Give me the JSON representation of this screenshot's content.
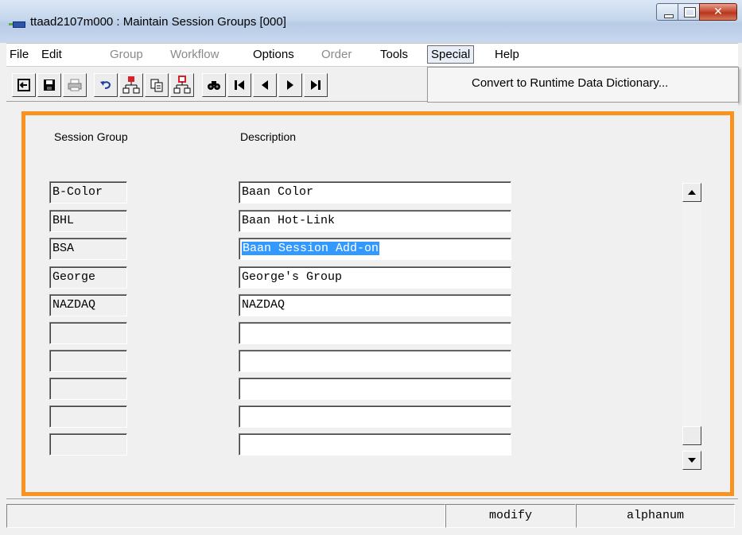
{
  "window": {
    "title": "ttaad2107m000 : Maintain Session Groups [000]"
  },
  "menu": {
    "items": [
      {
        "label": "File",
        "enabled": true
      },
      {
        "label": "Edit",
        "enabled": true
      },
      {
        "label": "Group",
        "enabled": false
      },
      {
        "label": "Workflow",
        "enabled": false
      },
      {
        "label": "Options",
        "enabled": true
      },
      {
        "label": "Order",
        "enabled": false
      },
      {
        "label": "Tools",
        "enabled": true
      },
      {
        "label": "Special",
        "enabled": true,
        "active": true
      },
      {
        "label": "Help",
        "enabled": true
      }
    ]
  },
  "dropdown": {
    "items": [
      "Convert to Runtime Data Dictionary..."
    ]
  },
  "toolbar": {
    "icons": [
      "exit-icon",
      "save-icon",
      "print-icon",
      "undo-icon",
      "insert-record-icon",
      "copy-icon",
      "duplicate-record-icon",
      "find-icon",
      "first-record-icon",
      "previous-record-icon",
      "next-record-icon",
      "last-record-icon"
    ]
  },
  "form": {
    "headers": {
      "code": "Session Group",
      "description": "Description"
    },
    "rows": [
      {
        "code": "B-Color",
        "description": "Baan Color",
        "selected": false
      },
      {
        "code": "BHL",
        "description": "Baan Hot-Link",
        "selected": false
      },
      {
        "code": "BSA",
        "description": "Baan Session Add-on",
        "selected": true
      },
      {
        "code": "George",
        "description": "George's Group",
        "selected": false
      },
      {
        "code": "NAZDAQ",
        "description": "NAZDAQ",
        "selected": false
      },
      {
        "code": "",
        "description": "",
        "selected": false
      },
      {
        "code": "",
        "description": "",
        "selected": false
      },
      {
        "code": "",
        "description": "",
        "selected": false
      },
      {
        "code": "",
        "description": "",
        "selected": false
      },
      {
        "code": "",
        "description": "",
        "selected": false
      }
    ]
  },
  "status": {
    "left": "",
    "mode": "modify",
    "input_type": "alphanum"
  },
  "colors": {
    "accent_border": "#f7931e",
    "selection": "#3399ff"
  }
}
